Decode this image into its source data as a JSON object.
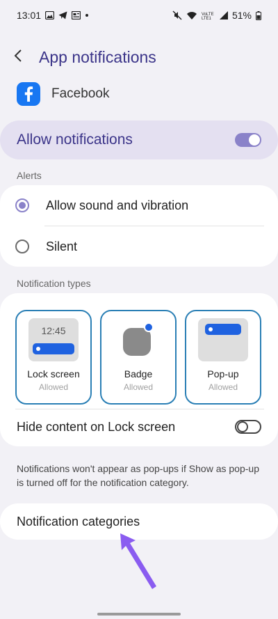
{
  "status_bar": {
    "time": "13:01",
    "battery": "51%",
    "network_label": "VoLTE LTE1"
  },
  "header": {
    "title": "App notifications"
  },
  "app": {
    "name": "Facebook",
    "brand_color": "#1877f2"
  },
  "allow_notifications": {
    "label": "Allow notifications",
    "enabled": true
  },
  "alerts": {
    "label": "Alerts",
    "options": [
      {
        "label": "Allow sound and vibration",
        "selected": true
      },
      {
        "label": "Silent",
        "selected": false
      }
    ]
  },
  "notification_types": {
    "label": "Notification types",
    "tiles": [
      {
        "title": "Lock screen",
        "status": "Allowed",
        "preview_time": "12:45"
      },
      {
        "title": "Badge",
        "status": "Allowed"
      },
      {
        "title": "Pop-up",
        "status": "Allowed"
      }
    ],
    "hide_content": {
      "label": "Hide content on Lock screen",
      "enabled": false
    }
  },
  "info": {
    "text": "Notifications won't appear as pop-ups if Show as pop-up is turned off for the notification category."
  },
  "categories": {
    "label": "Notification categories"
  },
  "colors": {
    "accent": "#3b3489",
    "toggle_on": "#8a82c9",
    "tile_border": "#2a7fb5",
    "notif_blue": "#1f62e0",
    "arrow": "#8a5cf0"
  }
}
